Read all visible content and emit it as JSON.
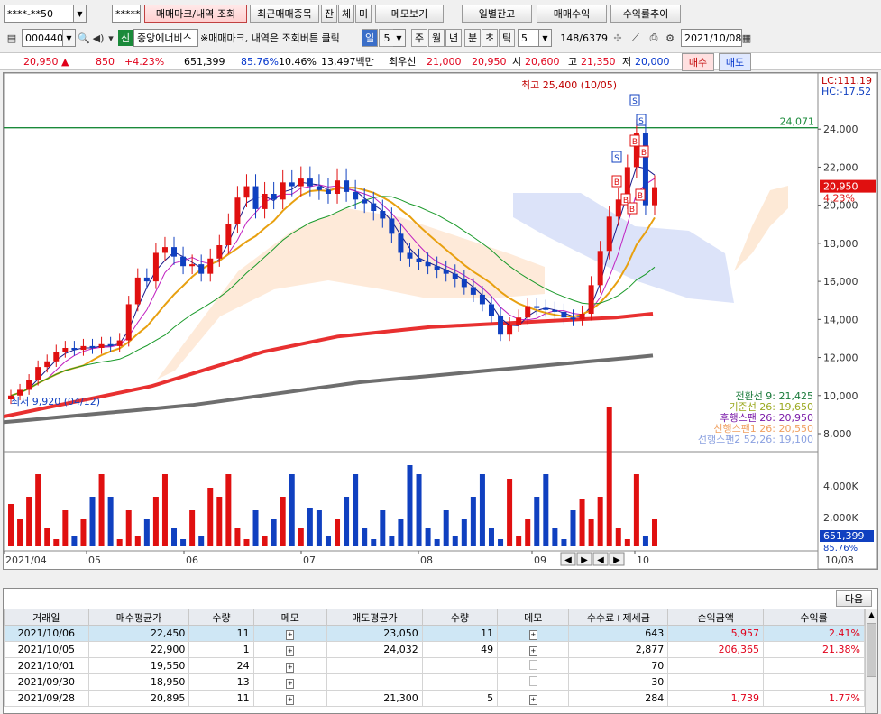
{
  "toolbar1": {
    "account_mask": "****-**50",
    "password_mask": "********",
    "tab_trade_mark": "매매마크/내역 조회",
    "recent_items": "최근매매종목",
    "btn_jan": "잔",
    "btn_che": "체",
    "btn_mi": "미",
    "memo_view": "메모보기",
    "daily_balance": "일별잔고",
    "trade_profit": "매매수익",
    "profit_trend": "수익률추이"
  },
  "toolbar2": {
    "stock_code": "000440",
    "badge_credit": "신",
    "stock_name": "중앙에너비스",
    "hint": "※매매마크, 내역은 조회버튼 클릭",
    "period_day": "일",
    "period_num": "5",
    "period_week": "주",
    "period_month": "월",
    "period_year": "년",
    "period_min": "분",
    "period_sec": "초",
    "period_tick": "틱",
    "count_value": "5",
    "range": "148/6379",
    "date": "2021/10/08"
  },
  "quote": {
    "price": "20,950",
    "change_arrow": "▲",
    "change": "850",
    "change_pct": "+4.23%",
    "volume": "651,399",
    "vol_ratio": "85.76%",
    "turnover": "10.46%",
    "amount": "13,497백만",
    "best_ask_label": "최우선",
    "best_ask": "21,000",
    "best_bid": "20,950",
    "open_label": "시",
    "open": "20,600",
    "high_label": "고",
    "high": "21,350",
    "low_label": "저",
    "low": "20,000",
    "buy_btn": "매수",
    "sell_btn": "매도"
  },
  "chart_data": {
    "type": "candlestick",
    "high_annotation": "최고 25,400 (10/05)",
    "low_annotation": "최저 9,920 (04/12)",
    "top_right_lc": "LC:111.19",
    "top_right_hc": "HC:-17.52",
    "hline_label": "24,071",
    "price_tag": "20,950",
    "pct_tag": "4.23%",
    "y_ticks": [
      "24,000",
      "22,000",
      "20,000",
      "18,000",
      "16,000",
      "14,000",
      "12,000",
      "10,000",
      "8,000"
    ],
    "y_range": [
      8000,
      26000
    ],
    "x_ticks": [
      "2021/04",
      "05",
      "06",
      "07",
      "08",
      "09",
      "10"
    ],
    "x_end": "10/08",
    "legend": [
      {
        "text": "전환선 9: 21,425",
        "color": "#1a7a3a"
      },
      {
        "text": "기준선 26: 19,650",
        "color": "#9aa81e"
      },
      {
        "text": "후행스팬 26: 20,950",
        "color": "#7a1aa8"
      },
      {
        "text": "선행스팬1 26: 20,550",
        "color": "#f0a060"
      },
      {
        "text": "선행스팬2 52,26: 19,100",
        "color": "#8aa0e0"
      }
    ],
    "trade_marks": [
      "S",
      "S",
      "S",
      "B",
      "B",
      "B",
      "B",
      "B",
      "B"
    ],
    "volume_ticks": [
      "4,000K",
      "2,000K"
    ],
    "volume_tag": "651,399",
    "vol_pct_tag": "85.76%",
    "closes": [
      10000,
      10300,
      10800,
      11500,
      11800,
      12300,
      12500,
      12400,
      12600,
      12500,
      12700,
      12600,
      12900,
      14800,
      16200,
      16000,
      17500,
      17800,
      17300,
      16800,
      16900,
      16400,
      17200,
      17900,
      19000,
      20400,
      21000,
      19800,
      20600,
      20300,
      21200,
      21000,
      21400,
      21000,
      20800,
      20600,
      21300,
      20700,
      20300,
      20100,
      19700,
      19300,
      18500,
      17500,
      17200,
      17000,
      16800,
      16600,
      16400,
      16100,
      15700,
      15300,
      14800,
      14200,
      13200,
      13700,
      14100,
      14700,
      14600,
      14500,
      14400,
      14100,
      14000,
      14300,
      15800,
      17600,
      19400,
      20300,
      22000,
      23800,
      20000,
      20950
    ],
    "ma_red": [
      8900,
      9100,
      9300,
      9500,
      9700,
      9900,
      10100,
      10300,
      10500,
      10800,
      11100,
      11400,
      11700,
      12000,
      12300,
      12500,
      12700,
      12900,
      13100,
      13200,
      13300,
      13400,
      13500,
      13600,
      13650,
      13700,
      13750,
      13800,
      13850,
      13900,
      13950,
      14000,
      14050,
      14100,
      14200,
      14300
    ],
    "ma_gray": [
      8600,
      8700,
      8800,
      8900,
      9000,
      9100,
      9200,
      9300,
      9400,
      9500,
      9650,
      9800,
      9950,
      10100,
      10250,
      10400,
      10550,
      10700,
      10800,
      10900,
      11000,
      11100,
      11200,
      11300,
      11400,
      11500,
      11600,
      11700,
      11800,
      11900,
      12000,
      12100
    ]
  },
  "grid": {
    "next_button": "다음",
    "headers": [
      "거래일",
      "매수평균가",
      "수량",
      "메모",
      "매도평균가",
      "수량",
      "메모",
      "수수료+제세금",
      "손익금액",
      "수익률"
    ],
    "rows": [
      [
        "2021/10/06",
        "22,450",
        "11",
        "",
        "23,050",
        "11",
        "",
        "643",
        "5,957",
        "2.41%"
      ],
      [
        "2021/10/05",
        "22,900",
        "1",
        "",
        "24,032",
        "49",
        "",
        "2,877",
        "206,365",
        "21.38%"
      ],
      [
        "2021/10/01",
        "19,550",
        "24",
        "",
        "",
        "",
        "",
        "70",
        "",
        ""
      ],
      [
        "2021/09/30",
        "18,950",
        "13",
        "",
        "",
        "",
        "",
        "30",
        "",
        ""
      ],
      [
        "2021/09/28",
        "20,895",
        "11",
        "",
        "21,300",
        "5",
        "",
        "284",
        "1,739",
        "1.77%"
      ]
    ]
  }
}
